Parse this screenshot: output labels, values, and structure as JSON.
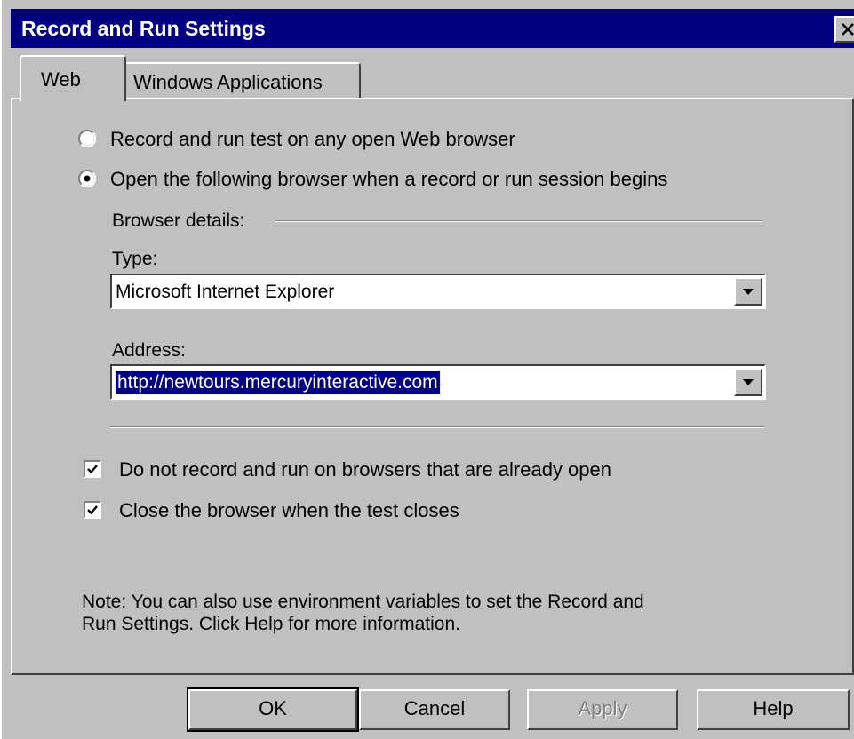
{
  "window": {
    "title": "Record and Run Settings",
    "close_label": "close"
  },
  "tabs": [
    {
      "label": "Web",
      "active": true
    },
    {
      "label": "Windows Applications",
      "active": false
    }
  ],
  "options": {
    "any_browser": {
      "label": "Record and run test on any open Web browser",
      "checked": false
    },
    "open_browser": {
      "label": "Open the following browser when a record or run session begins",
      "checked": true
    }
  },
  "browser_details": {
    "heading": "Browser details:",
    "type_label": "Type:",
    "type_value": "Microsoft Internet Explorer",
    "address_label": "Address:",
    "address_value": "http://newtours.mercuryinteractive.com"
  },
  "checkboxes": {
    "no_open_browsers": {
      "label": "Do not record and run on browsers that are already open",
      "checked": true
    },
    "close_browser": {
      "label": "Close the browser when the test closes",
      "checked": true
    }
  },
  "note": {
    "line1": "Note: You can also use environment variables to set the Record and",
    "line2": "Run Settings.  Click Help for more information."
  },
  "buttons": {
    "ok": "OK",
    "cancel": "Cancel",
    "apply": "Apply",
    "help": "Help"
  },
  "colors": {
    "titlebar": "#000080",
    "face": "#c0c0c0",
    "selection": "#000080"
  }
}
